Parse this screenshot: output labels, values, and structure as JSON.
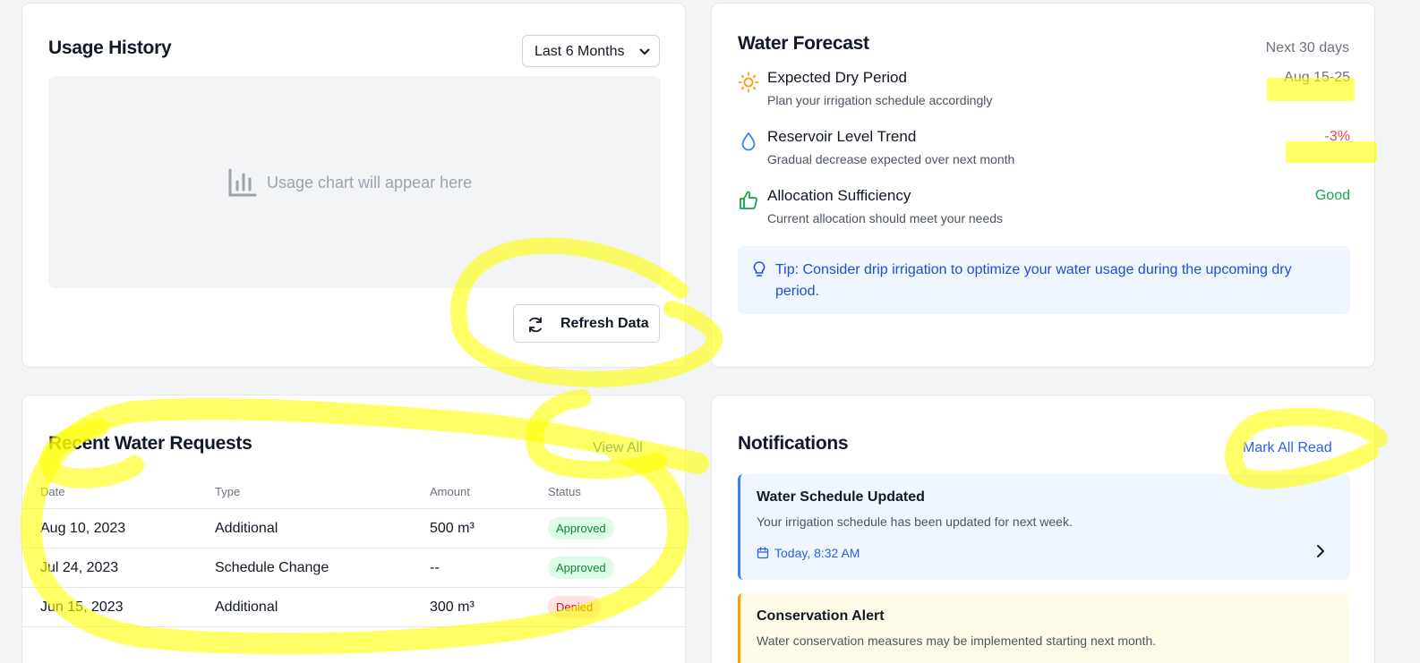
{
  "usage": {
    "title": "Usage History",
    "range_select": "Last 6 Months",
    "placeholder": "Usage chart will appear here",
    "refresh_label": "Refresh Data"
  },
  "forecast": {
    "title": "Water Forecast",
    "period": "Next 30 days",
    "items": [
      {
        "title": "Expected Dry Period",
        "subtitle": "Plan your irrigation schedule accordingly",
        "value": "Aug 15-25",
        "value_color": "#6b7280",
        "icon": "sun-icon"
      },
      {
        "title": "Reservoir Level Trend",
        "subtitle": "Gradual decrease expected over next month",
        "value": "-3%",
        "value_color": "#ef4444",
        "icon": "water-drop-icon"
      },
      {
        "title": "Allocation Sufficiency",
        "subtitle": "Current allocation should meet your needs",
        "value": "Good",
        "value_color": "#16a34a",
        "icon": "thumbs-up-icon"
      }
    ],
    "tip": "Tip: Consider drip irrigation to optimize your water usage during the upcoming dry period."
  },
  "requests": {
    "title": "Recent Water Requests",
    "view_all": "View All",
    "columns": [
      "Date",
      "Type",
      "Amount",
      "Status"
    ],
    "rows": [
      {
        "date": "Aug 10, 2023",
        "type": "Additional",
        "amount": "500 m³",
        "status": "Approved"
      },
      {
        "date": "Jul 24, 2023",
        "type": "Schedule Change",
        "amount": "--",
        "status": "Approved"
      },
      {
        "date": "Jun 15, 2023",
        "type": "Additional",
        "amount": "300 m³",
        "status": "Denied"
      }
    ]
  },
  "notifications": {
    "title": "Notifications",
    "mark_all": "Mark All Read",
    "items": [
      {
        "title": "Water Schedule Updated",
        "desc": "Your irrigation schedule has been updated for next week.",
        "time": "Today, 8:32 AM"
      },
      {
        "title": "Conservation Alert",
        "desc": "Water conservation measures may be implemented starting next month."
      }
    ]
  },
  "colors": {
    "accent": "#2563eb",
    "approved": "#15803d",
    "denied": "#b91c1c",
    "highlighter": "#ffff00"
  }
}
